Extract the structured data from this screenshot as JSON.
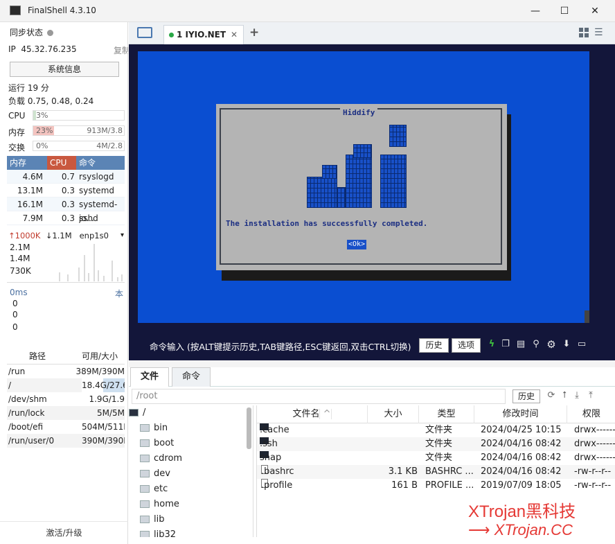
{
  "window": {
    "title": "FinalShell 4.3.10"
  },
  "sidebar": {
    "sync_label": "同步状态",
    "ip_label": "IP",
    "ip": "45.32.76.235",
    "copy": "复制",
    "sysinfo_button": "系统信息",
    "uptime": "运行 19 分",
    "load": "负载 0.75, 0.48, 0.24",
    "cpu": {
      "label": "CPU",
      "value": "3%",
      "percent": 3
    },
    "mem": {
      "label": "内存",
      "value": "23%",
      "percent": 23,
      "detail": "913M/3.8"
    },
    "swap": {
      "label": "交换",
      "value": "0%",
      "percent": 0,
      "detail": "4M/2.8"
    },
    "proc_headers": [
      "内存",
      "CPU",
      "命令"
    ],
    "processes": [
      {
        "mem": "4.6M",
        "cpu": "0.7",
        "cmd": "rsyslogd"
      },
      {
        "mem": "13.1M",
        "cpu": "0.3",
        "cmd": "systemd"
      },
      {
        "mem": "16.1M",
        "cpu": "0.3",
        "cmd": "systemd-jo..."
      },
      {
        "mem": "7.9M",
        "cpu": "0.3",
        "cmd": "sshd"
      }
    ],
    "net": {
      "up": "↑1000K",
      "down": "↓1.1M",
      "iface": "enp1s0",
      "levels": [
        "2.1M",
        "1.4M",
        "730K"
      ]
    },
    "latency": {
      "label": "0ms",
      "local": "本",
      "values": [
        "0",
        "0",
        "0"
      ]
    },
    "disk_headers": [
      "路径",
      "可用/大小"
    ],
    "disks": [
      {
        "path": "/run",
        "size": "389M/390M"
      },
      {
        "path": "/",
        "size": "18.4G/27.6"
      },
      {
        "path": "/dev/shm",
        "size": "1.9G/1.9"
      },
      {
        "path": "/run/lock",
        "size": "5M/5M"
      },
      {
        "path": "/boot/efi",
        "size": "504M/511M"
      },
      {
        "path": "/run/user/0",
        "size": "390M/390M"
      }
    ],
    "activate": "激活/升级"
  },
  "tabs": {
    "session": "1 IYIO.NET",
    "add": "+"
  },
  "terminal": {
    "dialog_title": "Hiddify",
    "message": "The installation has successfully completed.",
    "ok": "<Ok>"
  },
  "cmdbar": {
    "hint": "命令输入 (按ALT键提示历史,TAB键路径,ESC键返回,双击CTRL切换)",
    "history": "历史",
    "options": "选项"
  },
  "files": {
    "tab_files": "文件",
    "tab_commands": "命令",
    "path": "/root",
    "history": "历史",
    "tree_root": "/",
    "tree": [
      "bin",
      "boot",
      "cdrom",
      "dev",
      "etc",
      "home",
      "lib",
      "lib32"
    ],
    "columns": [
      "文件名",
      "大小",
      "类型",
      "修改时间",
      "权限"
    ],
    "rows": [
      {
        "name": ".cache",
        "size": "",
        "type": "文件夹",
        "time": "2024/04/25 10:15",
        "perm": "drwx------",
        "kind": "dir"
      },
      {
        "name": ".ssh",
        "size": "",
        "type": "文件夹",
        "time": "2024/04/16 08:42",
        "perm": "drwx------",
        "kind": "dir"
      },
      {
        "name": "snap",
        "size": "",
        "type": "文件夹",
        "time": "2024/04/16 08:42",
        "perm": "drwx------",
        "kind": "dir"
      },
      {
        "name": ".bashrc",
        "size": "3.1 KB",
        "type": "BASHRC ...",
        "time": "2024/04/16 08:42",
        "perm": "-rw-r--r--",
        "kind": "file"
      },
      {
        "name": ".profile",
        "size": "161 B",
        "type": "PROFILE ...",
        "time": "2019/07/09 18:05",
        "perm": "-rw-r--r--",
        "kind": "file"
      }
    ]
  },
  "watermark": {
    "line1": "XTrojan黑科技",
    "line2": "XTrojan.CC"
  },
  "colors": {
    "accent": "#5b84b5",
    "terminal_bg": "#13163a",
    "dialog_blue": "#0a4ed1",
    "watermark": "#e53935"
  }
}
